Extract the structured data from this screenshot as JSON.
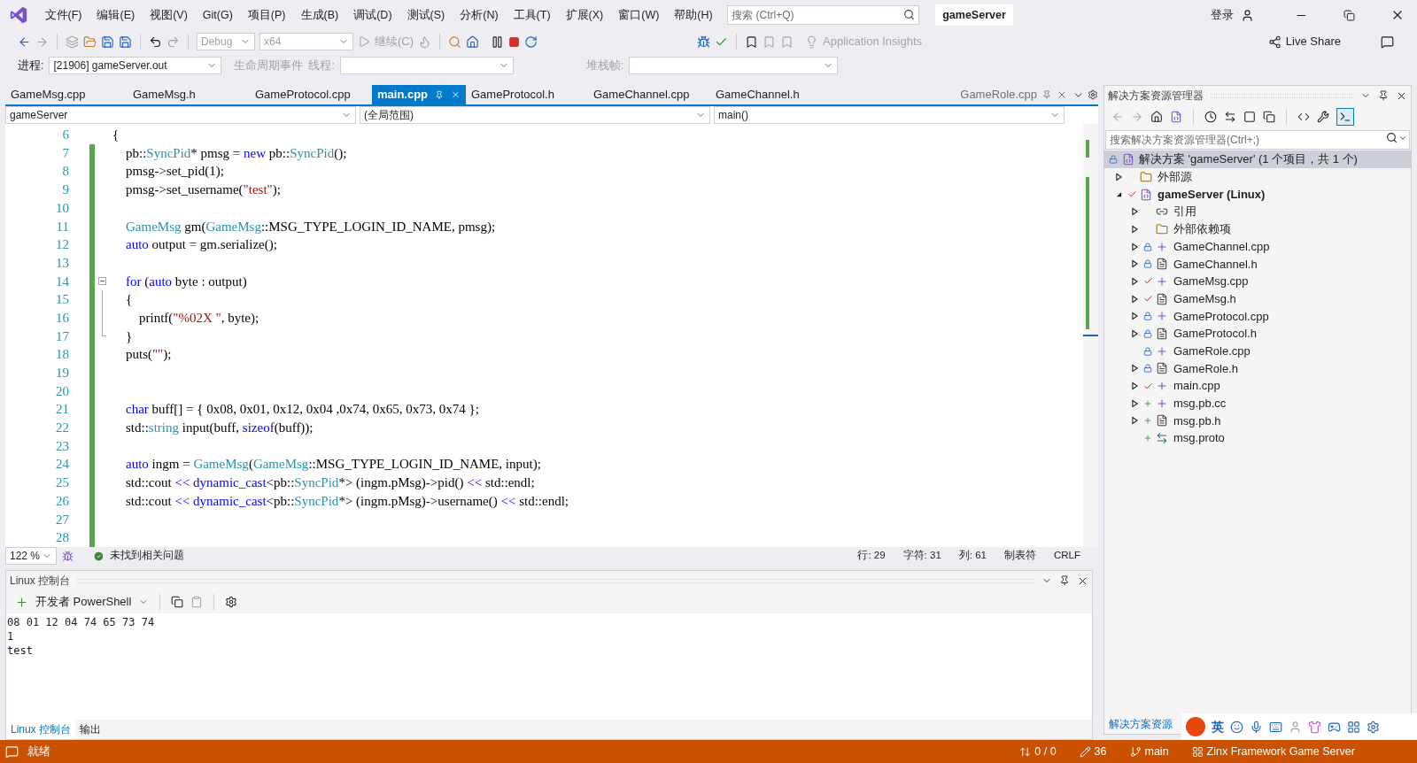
{
  "menu": {
    "items": [
      "文件(F)",
      "编辑(E)",
      "视图(V)",
      "Git(G)",
      "项目(P)",
      "生成(B)",
      "调试(D)",
      "测试(S)",
      "分析(N)",
      "工具(T)",
      "扩展(X)",
      "窗口(W)",
      "帮助(H)"
    ],
    "search_placeholder": "搜索 (Ctrl+Q)",
    "solution_name": "gameServer",
    "sign_in": "登录"
  },
  "toolbar": {
    "configuration": "Debug",
    "platform": "x64",
    "continue": "继续(C)",
    "insights": "Application Insights",
    "live_share": "Live Share"
  },
  "debug_bar": {
    "process_label": "进程:",
    "process": "[21906] gameServer.out",
    "lifecycle": "生命周期事件",
    "thread_label": "线程:",
    "stack_label": "堆栈帧:"
  },
  "doc_tabs": [
    {
      "label": "GameMsg.cpp",
      "selected": false
    },
    {
      "label": "GameMsg.h",
      "selected": false
    },
    {
      "label": "GameProtocol.cpp",
      "selected": false
    },
    {
      "label": "main.cpp",
      "selected": true
    },
    {
      "label": "GameProtocol.h",
      "selected": false
    },
    {
      "label": "GameChannel.cpp",
      "selected": false
    },
    {
      "label": "GameChannel.h",
      "selected": false
    }
  ],
  "preview_tab": {
    "label": "GameRole.cpp"
  },
  "nav_bar": {
    "project": "gameServer",
    "scope": "(全局范围)",
    "member": "main()"
  },
  "editor": {
    "lines": [
      {
        "number": "6",
        "changed": false,
        "fold_start": false,
        "in_fold": false,
        "tokens": [
          {
            "t": "{",
            "kind": "plain"
          }
        ]
      },
      {
        "number": "7",
        "changed": true,
        "fold_start": false,
        "in_fold": false,
        "tokens": [
          {
            "t": "    pb::",
            "kind": "plain"
          },
          {
            "t": "SyncPid",
            "kind": "type"
          },
          {
            "t": "* pmsg = ",
            "kind": "plain"
          },
          {
            "t": "new",
            "kind": "keyword"
          },
          {
            "t": " pb::",
            "kind": "plain"
          },
          {
            "t": "SyncPid",
            "kind": "type"
          },
          {
            "t": "();",
            "kind": "plain"
          }
        ]
      },
      {
        "number": "8",
        "changed": true,
        "fold_start": false,
        "in_fold": false,
        "tokens": [
          {
            "t": "    pmsg->set_pid(1);",
            "kind": "plain"
          }
        ]
      },
      {
        "number": "9",
        "changed": true,
        "fold_start": false,
        "in_fold": false,
        "tokens": [
          {
            "t": "    pmsg->set_username(",
            "kind": "plain"
          },
          {
            "t": "\"test\"",
            "kind": "string"
          },
          {
            "t": ");",
            "kind": "plain"
          }
        ]
      },
      {
        "number": "10",
        "changed": true,
        "fold_start": false,
        "in_fold": false
      },
      {
        "number": "11",
        "changed": true,
        "fold_start": false,
        "in_fold": false,
        "tokens": [
          {
            "t": "    GameMsg",
            "kind": "type"
          },
          {
            "t": " gm(",
            "kind": "plain"
          },
          {
            "t": "GameMsg",
            "kind": "type"
          },
          {
            "t": "::MSG_TYPE_LOGIN_ID_NAME, pmsg);",
            "kind": "plain"
          }
        ]
      },
      {
        "number": "12",
        "changed": true,
        "fold_start": false,
        "in_fold": false,
        "tokens": [
          {
            "t": "    auto",
            "kind": "keyword"
          },
          {
            "t": " output = gm.serialize();",
            "kind": "plain"
          }
        ]
      },
      {
        "number": "13",
        "changed": true,
        "fold_start": false,
        "in_fold": false
      },
      {
        "number": "14",
        "changed": true,
        "fold_start": true,
        "in_fold": false,
        "tokens": [
          {
            "t": "    for",
            "kind": "keyword"
          },
          {
            "t": " (",
            "kind": "plain"
          },
          {
            "t": "auto",
            "kind": "keyword"
          },
          {
            "t": " byte : output)",
            "kind": "plain"
          }
        ]
      },
      {
        "number": "15",
        "changed": true,
        "fold_start": false,
        "in_fold": true,
        "tokens": [
          {
            "t": "    {",
            "kind": "plain"
          }
        ]
      },
      {
        "number": "16",
        "changed": true,
        "fold_start": false,
        "in_fold": true,
        "tokens": [
          {
            "t": "        printf(",
            "kind": "plain"
          },
          {
            "t": "\"%02X \"",
            "kind": "string"
          },
          {
            "t": ", byte);",
            "kind": "plain"
          }
        ]
      },
      {
        "number": "17",
        "changed": true,
        "fold_start": false,
        "in_fold": true,
        "tokens": [
          {
            "t": "    }",
            "kind": "plain"
          }
        ]
      },
      {
        "number": "18",
        "changed": true,
        "fold_start": false,
        "in_fold": false,
        "tokens": [
          {
            "t": "    puts(",
            "kind": "plain"
          },
          {
            "t": "\"\"",
            "kind": "string"
          },
          {
            "t": ");",
            "kind": "plain"
          }
        ]
      },
      {
        "number": "19",
        "changed": true,
        "fold_start": false,
        "in_fold": false
      },
      {
        "number": "20",
        "changed": true,
        "fold_start": false,
        "in_fold": false
      },
      {
        "number": "21",
        "changed": true,
        "fold_start": false,
        "in_fold": false,
        "tokens": [
          {
            "t": "    char",
            "kind": "keyword"
          },
          {
            "t": " buff[] = { 0x08, 0x01, 0x12, 0x04 ,0x74, 0x65, 0x73, 0x74 };",
            "kind": "plain"
          }
        ]
      },
      {
        "number": "22",
        "changed": true,
        "fold_start": false,
        "in_fold": false,
        "tokens": [
          {
            "t": "    std::",
            "kind": "plain"
          },
          {
            "t": "string",
            "kind": "type"
          },
          {
            "t": " input(buff, ",
            "kind": "plain"
          },
          {
            "t": "sizeof",
            "kind": "keyword"
          },
          {
            "t": "(buff));",
            "kind": "plain"
          }
        ]
      },
      {
        "number": "23",
        "changed": true,
        "fold_start": false,
        "in_fold": false
      },
      {
        "number": "24",
        "changed": true,
        "fold_start": false,
        "in_fold": false,
        "tokens": [
          {
            "t": "    auto",
            "kind": "keyword"
          },
          {
            "t": " ingm = ",
            "kind": "plain"
          },
          {
            "t": "GameMsg",
            "kind": "type"
          },
          {
            "t": "(",
            "kind": "plain"
          },
          {
            "t": "GameMsg",
            "kind": "type"
          },
          {
            "t": "::MSG_TYPE_LOGIN_ID_NAME, input);",
            "kind": "plain"
          }
        ]
      },
      {
        "number": "25",
        "changed": true,
        "fold_start": false,
        "in_fold": false,
        "tokens": [
          {
            "t": "    std::cout ",
            "kind": "plain"
          },
          {
            "t": "<< dynamic_cast",
            "kind": "keyword"
          },
          {
            "t": "<pb::",
            "kind": "plain"
          },
          {
            "t": "SyncPid",
            "kind": "type"
          },
          {
            "t": "*> (ingm.pMsg)->pid() ",
            "kind": "plain"
          },
          {
            "t": "<<",
            "kind": "keyword"
          },
          {
            "t": " std::endl;",
            "kind": "plain"
          }
        ]
      },
      {
        "number": "26",
        "changed": true,
        "fold_start": false,
        "in_fold": false,
        "tokens": [
          {
            "t": "    std::cout ",
            "kind": "plain"
          },
          {
            "t": "<< dynamic_cast",
            "kind": "keyword"
          },
          {
            "t": "<pb::",
            "kind": "plain"
          },
          {
            "t": "SyncPid",
            "kind": "type"
          },
          {
            "t": "*> (ingm.pMsg)->username() ",
            "kind": "plain"
          },
          {
            "t": "<<",
            "kind": "keyword"
          },
          {
            "t": " std::endl;",
            "kind": "plain"
          }
        ]
      },
      {
        "number": "27",
        "changed": true,
        "fold_start": false,
        "in_fold": false
      },
      {
        "number": "28",
        "changed": true,
        "fold_start": false,
        "in_fold": false
      }
    ]
  },
  "editor_status": {
    "zoom": "122 %",
    "issues": "未找到相关问题",
    "line": "行: 29",
    "char": "字符: 31",
    "col": "列: 61",
    "indent": "制表符",
    "eol": "CRLF"
  },
  "output_panel": {
    "title": "Linux 控制台",
    "shell": "开发者 PowerShell",
    "lines": [
      "08 01 12 04 74 65 73 74",
      "1",
      "test"
    ],
    "tabs": [
      {
        "label": "Linux 控制台",
        "selected": true
      },
      {
        "label": "输出",
        "selected": false
      }
    ]
  },
  "solution_explorer": {
    "title": "解决方案资源管理器",
    "search_placeholder": "搜索解决方案资源管理器(Ctrl+;)",
    "bottom_tab": "解决方案资源",
    "root": {
      "label": "解决方案 'gameServer' (1 个项目，共 1 个)",
      "children": [
        {
          "label": "外部源",
          "kind": "external",
          "expandable": true,
          "expanded": false,
          "locked": false,
          "modified": false,
          "added": false
        },
        {
          "label": "gameServer (Linux)",
          "kind": "project",
          "expandable": true,
          "expanded": true,
          "locked": false,
          "modified": true,
          "added": false,
          "children": [
            {
              "label": "引用",
              "kind": "refs",
              "expandable": true,
              "expanded": false,
              "locked": false,
              "modified": false,
              "added": false
            },
            {
              "label": "外部依赖项",
              "kind": "external",
              "expandable": true,
              "expanded": false,
              "locked": false,
              "modified": false,
              "added": false
            },
            {
              "label": "GameChannel.cpp",
              "kind": "cpp",
              "expandable": true,
              "expanded": false,
              "locked": true,
              "modified": false,
              "added": false
            },
            {
              "label": "GameChannel.h",
              "kind": "h",
              "expandable": true,
              "expanded": false,
              "locked": true,
              "modified": false,
              "added": false
            },
            {
              "label": "GameMsg.cpp",
              "kind": "cpp",
              "expandable": true,
              "expanded": false,
              "locked": false,
              "modified": true,
              "added": false
            },
            {
              "label": "GameMsg.h",
              "kind": "h",
              "expandable": true,
              "expanded": false,
              "locked": false,
              "modified": true,
              "added": false
            },
            {
              "label": "GameProtocol.cpp",
              "kind": "cpp",
              "expandable": true,
              "expanded": false,
              "locked": true,
              "modified": false,
              "added": false
            },
            {
              "label": "GameProtocol.h",
              "kind": "h",
              "expandable": true,
              "expanded": false,
              "locked": true,
              "modified": false,
              "added": false
            },
            {
              "label": "GameRole.cpp",
              "kind": "cpp",
              "expandable": false,
              "expanded": false,
              "locked": true,
              "modified": false,
              "added": false
            },
            {
              "label": "GameRole.h",
              "kind": "h",
              "expandable": true,
              "expanded": false,
              "locked": true,
              "modified": false,
              "added": false
            },
            {
              "label": "main.cpp",
              "kind": "cpp",
              "expandable": true,
              "expanded": false,
              "locked": false,
              "modified": true,
              "added": false
            },
            {
              "label": "msg.pb.cc",
              "kind": "cpp",
              "expandable": true,
              "expanded": false,
              "locked": false,
              "modified": false,
              "added": true
            },
            {
              "label": "msg.pb.h",
              "kind": "h",
              "expandable": true,
              "expanded": false,
              "locked": false,
              "modified": false,
              "added": true
            },
            {
              "label": "msg.proto",
              "kind": "proto",
              "expandable": false,
              "expanded": false,
              "locked": false,
              "modified": false,
              "added": true
            }
          ]
        }
      ]
    }
  },
  "status_bar": {
    "state": "就绪",
    "changes": "0 / 0",
    "edits": "36",
    "branch": "main",
    "repo": "Zinx Framework Game Server"
  },
  "ime_bar": {
    "mode": "英"
  }
}
